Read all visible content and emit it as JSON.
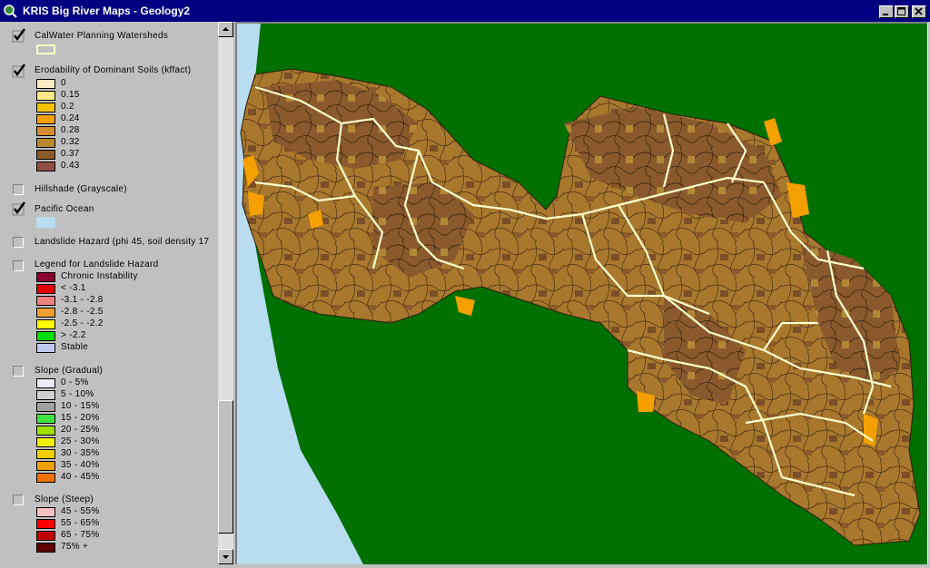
{
  "window": {
    "title": "KRIS Big River Maps - Geology2",
    "buttons": {
      "minimize": "_",
      "maximize": "□",
      "close": "×"
    }
  },
  "colors": {
    "title_bar": "#000080",
    "ocean": "#b8dcf0",
    "land_background": "#007000",
    "watershed_lines": "#ffffcc"
  },
  "toc": {
    "layers": [
      {
        "name": "CalWater Planning Watersheds",
        "checked": true,
        "legend": [
          {
            "color": "#ffffcc",
            "label": ""
          }
        ]
      },
      {
        "name": "Erodability of Dominant Soils (kffact)",
        "checked": true,
        "legend": [
          {
            "color": "#fde9c4",
            "label": "0"
          },
          {
            "color": "#fde88a",
            "label": "0.15"
          },
          {
            "color": "#f7c400",
            "label": "0.2"
          },
          {
            "color": "#f5a000",
            "label": "0.24"
          },
          {
            "color": "#d88a30",
            "label": "0.28"
          },
          {
            "color": "#b8882e",
            "label": "0.32"
          },
          {
            "color": "#8c5a28",
            "label": "0.37"
          },
          {
            "color": "#8e4d40",
            "label": "0.43"
          }
        ]
      },
      {
        "name": "Hillshade (Grayscale)",
        "checked": false,
        "legend": []
      },
      {
        "name": "Pacific Ocean",
        "checked": true,
        "legend": [
          {
            "color": "#b8dcf0",
            "label": ""
          }
        ]
      },
      {
        "name": "Landslide Hazard (phi 45, soil density 17",
        "checked": false,
        "legend": []
      },
      {
        "name": "Legend for Landslide Hazard",
        "checked": false,
        "legend": [
          {
            "color": "#8b0030",
            "label": "Chronic Instability"
          },
          {
            "color": "#e00000",
            "label": "< -3.1"
          },
          {
            "color": "#f08080",
            "label": "-3.1 - -2.8"
          },
          {
            "color": "#f0a030",
            "label": "-2.8 - -2.5"
          },
          {
            "color": "#ffff00",
            "label": "-2.5 - -2.2"
          },
          {
            "color": "#00e000",
            "label": "> -2.2"
          },
          {
            "color": "#c0c8f0",
            "label": "Stable"
          }
        ]
      },
      {
        "name": "Slope (Gradual)",
        "checked": false,
        "legend": [
          {
            "color": "#ececf8",
            "label": "0 - 5%"
          },
          {
            "color": "#d0d0d0",
            "label": "5 - 10%"
          },
          {
            "color": "#a0a0a0",
            "label": "10 - 15%"
          },
          {
            "color": "#40e040",
            "label": "15 - 20%"
          },
          {
            "color": "#a0e000",
            "label": "20 - 25%"
          },
          {
            "color": "#f0f000",
            "label": "25 - 30%"
          },
          {
            "color": "#f0d000",
            "label": "30 - 35%"
          },
          {
            "color": "#f0a000",
            "label": "35 - 40%"
          },
          {
            "color": "#f07000",
            "label": "40 - 45%"
          }
        ]
      },
      {
        "name": "Slope (Steep)",
        "checked": false,
        "legend": [
          {
            "color": "#f8c0c0",
            "label": "45 - 55%"
          },
          {
            "color": "#ff0000",
            "label": "55 - 65%"
          },
          {
            "color": "#c00000",
            "label": "65 - 75%"
          },
          {
            "color": "#600000",
            "label": "75% +"
          }
        ]
      }
    ]
  }
}
